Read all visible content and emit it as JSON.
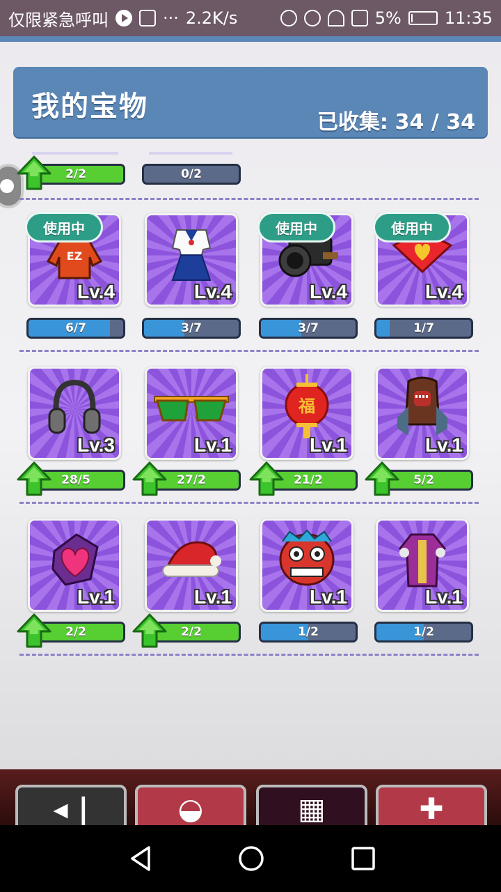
{
  "statusbar": {
    "carrier": "仅限紧急呼叫",
    "more": "···",
    "speed": "2.2K/s",
    "battery_pct": "5%",
    "battery_level": 0.05,
    "time": "11:35"
  },
  "header": {
    "title": "我的宝物",
    "collected_label": "已收集:",
    "collected_value": "34 / 34"
  },
  "in_use_label": "使用中",
  "partial_row": [
    {
      "progress": "2/2",
      "fill": 1.0,
      "upgrade": true
    },
    {
      "progress": "0/2",
      "fill": 0.0,
      "upgrade": false
    }
  ],
  "items": [
    {
      "name": "red-hoodie",
      "level": "Lv.4",
      "progress": "6/7",
      "fill": 0.857,
      "in_use": true,
      "upgrade": false
    },
    {
      "name": "sailor-uniform",
      "level": "Lv.4",
      "progress": "3/7",
      "fill": 0.43,
      "in_use": false,
      "upgrade": false
    },
    {
      "name": "camera",
      "level": "Lv.4",
      "progress": "3/7",
      "fill": 0.43,
      "in_use": true,
      "upgrade": false
    },
    {
      "name": "heart-fan",
      "level": "Lv.4",
      "progress": "1/7",
      "fill": 0.143,
      "in_use": true,
      "upgrade": false
    },
    {
      "name": "headphones",
      "level": "Lv.3",
      "progress": "28/5",
      "fill": 1.0,
      "in_use": false,
      "upgrade": true
    },
    {
      "name": "sunglasses",
      "level": "Lv.1",
      "progress": "27/2",
      "fill": 1.0,
      "in_use": false,
      "upgrade": true
    },
    {
      "name": "red-lantern",
      "level": "Lv.1",
      "progress": "21/2",
      "fill": 1.0,
      "in_use": false,
      "upgrade": true
    },
    {
      "name": "monster-backpack",
      "level": "Lv.1",
      "progress": "5/2",
      "fill": 1.0,
      "in_use": false,
      "upgrade": true
    },
    {
      "name": "heart-ring",
      "level": "Lv.1",
      "progress": "2/2",
      "fill": 1.0,
      "in_use": false,
      "upgrade": true
    },
    {
      "name": "santa-hat",
      "level": "Lv.1",
      "progress": "2/2",
      "fill": 1.0,
      "in_use": false,
      "upgrade": true
    },
    {
      "name": "lion-mask",
      "level": "Lv.1",
      "progress": "1/2",
      "fill": 0.5,
      "in_use": false,
      "upgrade": false
    },
    {
      "name": "purple-robe",
      "level": "Lv.1",
      "progress": "1/2",
      "fill": 0.5,
      "in_use": false,
      "upgrade": false
    }
  ],
  "colors": {
    "header": "#5a87b6",
    "bar_bg": "#5b6a89",
    "bar_blue": "#3a95d8",
    "bar_green": "#57cf33",
    "inuse": "#2e9d87"
  }
}
